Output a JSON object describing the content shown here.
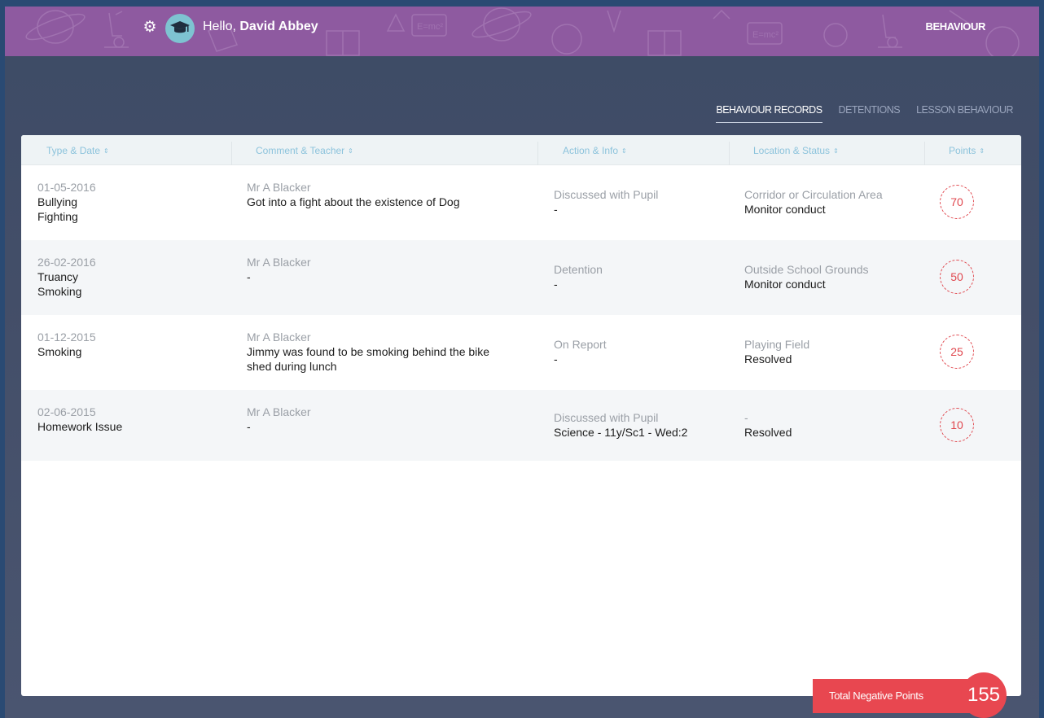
{
  "header": {
    "greeting_prefix": "Hello,",
    "user_name": "David Abbey",
    "nav_label": "BEHAVIOUR",
    "doodle_text": "E=mc²"
  },
  "tabs": [
    {
      "label": "BEHAVIOUR RECORDS",
      "active": true
    },
    {
      "label": "DETENTIONS",
      "active": false
    },
    {
      "label": "LESSON BEHAVIOUR",
      "active": false
    }
  ],
  "table": {
    "columns": [
      "Type & Date",
      "Comment & Teacher",
      "Action & Info",
      "Location & Status",
      "Points"
    ],
    "sort_glyph": "⇕",
    "rows": [
      {
        "date": "01-05-2016",
        "type1": "Bullying",
        "type2": "Fighting",
        "teacher": "Mr A Blacker",
        "comment1": "Got into a fight about the existence of Dog",
        "comment2": "",
        "action": "Discussed with Pupil",
        "info": "-",
        "location": "Corridor or Circulation Area",
        "status": "Monitor conduct",
        "points": "70"
      },
      {
        "date": "26-02-2016",
        "type1": "Truancy",
        "type2": "Smoking",
        "teacher": "Mr A Blacker",
        "comment1": "-",
        "comment2": "",
        "action": "Detention",
        "info": "-",
        "location": "Outside School Grounds",
        "status": "Monitor conduct",
        "points": "50"
      },
      {
        "date": "01-12-2015",
        "type1": "Smoking",
        "type2": "",
        "teacher": "Mr A Blacker",
        "comment1": "Jimmy was found to be smoking behind the bike",
        "comment2": "shed during lunch",
        "action": "On Report",
        "info": "-",
        "location": "Playing Field",
        "status": "Resolved",
        "points": "25"
      },
      {
        "date": "02-06-2015",
        "type1": "Homework Issue",
        "type2": "",
        "teacher": "Mr A Blacker",
        "comment1": "-",
        "comment2": "",
        "action": "Discussed with Pupil",
        "info": "Science - 11y/Sc1 - Wed:2",
        "location": "-",
        "status": "Resolved",
        "points": "10"
      }
    ]
  },
  "total": {
    "label": "Total Negative Points",
    "value": "155"
  },
  "colors": {
    "header_bg": "#8e5aa0",
    "accent_red": "#e84750",
    "header_text": "#8cc3dc",
    "page_bg": "#434e68"
  }
}
